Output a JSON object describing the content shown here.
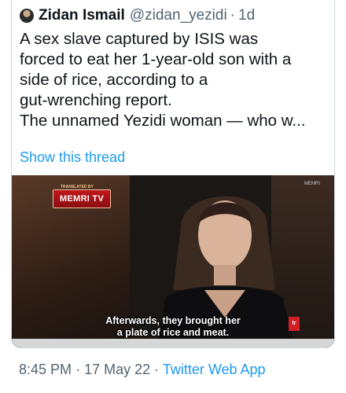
{
  "tweet": {
    "author_name": "Zidan Ismail",
    "author_handle": "@zidan_yezidi",
    "separator": "·",
    "age": "1d",
    "text_lines": [
      "A sex slave captured by ISIS was",
      "forced to eat her 1-year-old son with a",
      "side of rice, according to a",
      "gut-wrenching report.",
      "The unnamed Yezidi woman — who w..."
    ],
    "show_thread": "Show this thread"
  },
  "media": {
    "brand_small": "TRANSLATED BY",
    "brand": "MEMRI TV",
    "watermark": "MEMRI",
    "subtitle_lines": [
      "Afterwards, they brought her",
      "a plate of rice and meat."
    ],
    "logo_right": "tr"
  },
  "footer": {
    "time": "8:45 PM",
    "separator": "·",
    "date": "17 May 22",
    "app": "Twitter Web App"
  },
  "colors": {
    "link": "#1d9bf0",
    "secondary_text": "#536471",
    "primary_text": "#0f1419",
    "border": "#cfd9de"
  }
}
